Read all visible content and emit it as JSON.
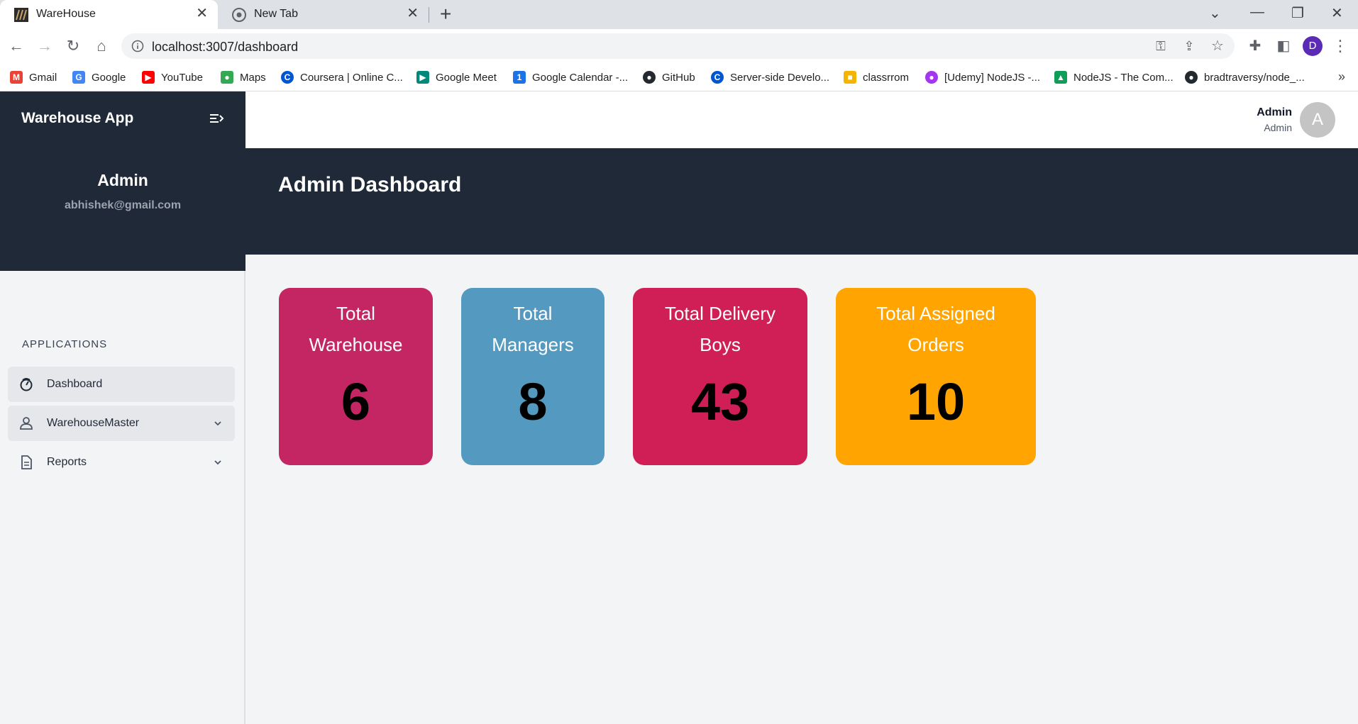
{
  "browser": {
    "tabs": [
      {
        "title": "WareHouse",
        "active": true
      },
      {
        "title": "New Tab",
        "active": false
      }
    ],
    "url": "localhost:3007/dashboard",
    "profile_initial": "D",
    "bookmarks": [
      {
        "label": "Gmail",
        "color": "#ea4335",
        "glyph": "M"
      },
      {
        "label": "Google",
        "color": "#4285f4",
        "glyph": "G"
      },
      {
        "label": "YouTube",
        "color": "#ff0000",
        "glyph": "▶"
      },
      {
        "label": "Maps",
        "color": "#34a853",
        "glyph": "●"
      },
      {
        "label": "Coursera | Online C...",
        "color": "#0056d2",
        "glyph": "C"
      },
      {
        "label": "Google Meet",
        "color": "#00897b",
        "glyph": "▶"
      },
      {
        "label": "Google Calendar -...",
        "color": "#1a73e8",
        "glyph": "1"
      },
      {
        "label": "GitHub",
        "color": "#24292f",
        "glyph": "●"
      },
      {
        "label": "Server-side Develo...",
        "color": "#0056d2",
        "glyph": "C"
      },
      {
        "label": "classrrom",
        "color": "#f4b400",
        "glyph": "■"
      },
      {
        "label": "[Udemy] NodeJS -...",
        "color": "#a435f0",
        "glyph": "●"
      },
      {
        "label": "NodeJS - The Com...",
        "color": "#0f9d58",
        "glyph": "▲"
      },
      {
        "label": "bradtraversy/node_...",
        "color": "#24292f",
        "glyph": "●"
      }
    ]
  },
  "sidebar": {
    "app_title": "Warehouse App",
    "user_name": "Admin",
    "user_email": "abhishek@gmail.com",
    "section_label": "APPLICATIONS",
    "items": [
      {
        "label": "Dashboard",
        "icon": "dashboard-icon"
      },
      {
        "label": "WarehouseMaster",
        "icon": "user-icon"
      },
      {
        "label": "Reports",
        "icon": "document-icon"
      }
    ]
  },
  "topbar": {
    "user_name": "Admin",
    "user_role": "Admin",
    "avatar_initial": "A"
  },
  "banner": {
    "title": "Admin Dashboard"
  },
  "cards": [
    {
      "label": "Total Warehouse",
      "value": "6",
      "color": "#c42563"
    },
    {
      "label": "Total Managers",
      "value": "8",
      "color": "#5499bf"
    },
    {
      "label": "Total Delivery Boys",
      "value": "43",
      "color": "#cf1f56"
    },
    {
      "label": "Total Assigned Orders",
      "value": "10",
      "color": "#ffa400"
    }
  ]
}
